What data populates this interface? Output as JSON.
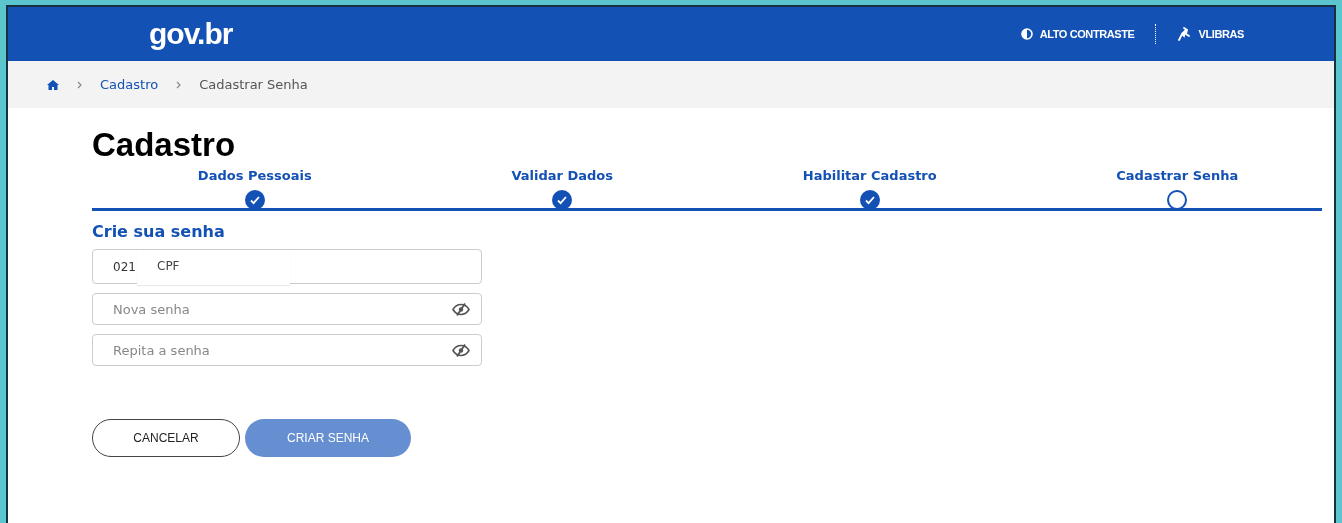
{
  "header": {
    "logo": "gov.br",
    "actions": [
      {
        "kind": "contrast",
        "label": "ALTO CONTRASTE"
      },
      {
        "kind": "vlibras",
        "label": "VLIBRAS"
      }
    ]
  },
  "breadcrumb": [
    {
      "label": "Cadastro",
      "link": true
    },
    {
      "label": "Cadastrar Senha",
      "link": false
    }
  ],
  "title": "Cadastro",
  "steps": [
    {
      "label": "Dados Pessoais",
      "done": true
    },
    {
      "label": "Validar Dados",
      "done": true
    },
    {
      "label": "Habilitar Cadastro",
      "done": true
    },
    {
      "label": "Cadastrar Senha",
      "done": false
    }
  ],
  "form": {
    "heading": "Crie sua senha",
    "cpf": {
      "value": "021",
      "overlay": "CPF"
    },
    "fields": [
      {
        "placeholder": "Nova senha"
      },
      {
        "placeholder": "Repita a senha"
      }
    ]
  },
  "buttons": [
    {
      "kind": "secondary",
      "label": "CANCELAR"
    },
    {
      "kind": "primary",
      "label": "CRIAR SENHA"
    }
  ]
}
